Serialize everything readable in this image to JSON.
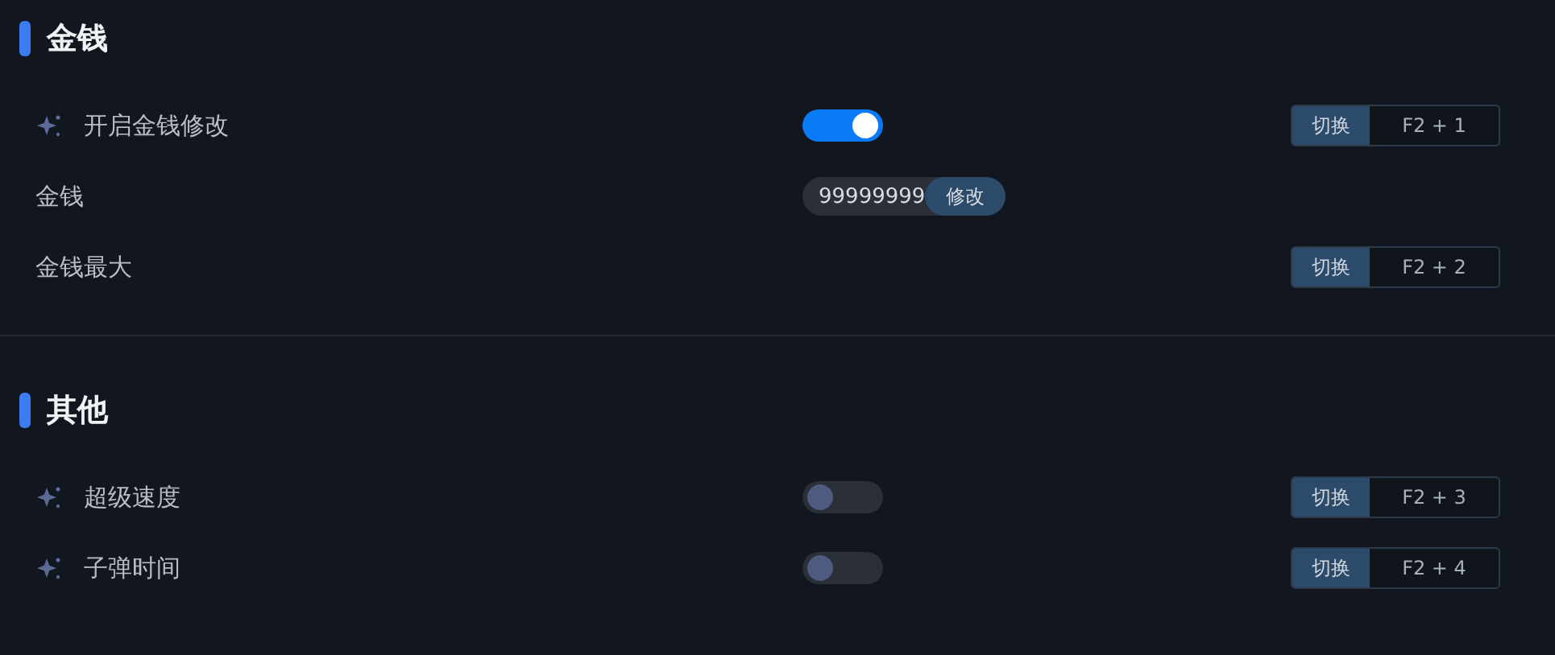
{
  "sections": [
    {
      "title": "金钱",
      "rows": [
        {
          "kind": "toggle",
          "sparkle": true,
          "label": "开启金钱修改",
          "on": true,
          "hotkey": {
            "action": "切换",
            "keys": "F2 + 1"
          }
        },
        {
          "kind": "number",
          "sparkle": false,
          "label": "金钱",
          "value": "99999999",
          "button": "修改"
        },
        {
          "kind": "plain",
          "sparkle": false,
          "label": "金钱最大",
          "hotkey": {
            "action": "切换",
            "keys": "F2 + 2"
          }
        }
      ]
    },
    {
      "title": "其他",
      "rows": [
        {
          "kind": "toggle",
          "sparkle": true,
          "label": "超级速度",
          "on": false,
          "hotkey": {
            "action": "切换",
            "keys": "F2 + 3"
          }
        },
        {
          "kind": "toggle",
          "sparkle": true,
          "label": "子弹时间",
          "on": false,
          "hotkey": {
            "action": "切换",
            "keys": "F2 + 4"
          }
        }
      ]
    }
  ]
}
